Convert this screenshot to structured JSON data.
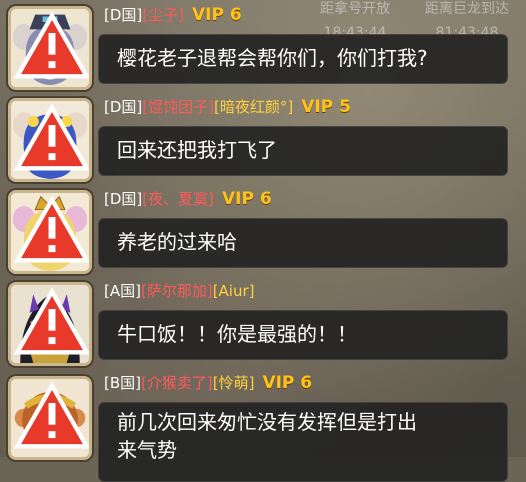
{
  "hud": {
    "left_title": "距拿号开放",
    "left_time": "18:43:44",
    "right_title": "距离巨龙到达",
    "right_time": "81:43:48"
  },
  "messages": [
    {
      "server": "[D国]",
      "nick": "[尘子]",
      "tag": "",
      "vip": "VIP 6",
      "text": "樱花老子退帮会帮你们，你们打我?"
    },
    {
      "server": "[D国]",
      "nick": "[馄饨团子]",
      "tag": "[暗夜红颜°]",
      "vip": "VIP 5",
      "text": "回来还把我打飞了"
    },
    {
      "server": "[D国]",
      "nick": "[夜、夏寞]",
      "tag": "",
      "vip": "VIP 6",
      "text": "养老的过来哈"
    },
    {
      "server": "[A国]",
      "nick": "[萨尔那加]",
      "tag": "[Aiur]",
      "vip": "",
      "text": "牛口饭！！你是最强的！！"
    },
    {
      "server": "[B国]",
      "nick": "[介猴卖了]",
      "tag": "[怜萌]",
      "vip": "VIP 6",
      "text": "前几次回来匆忙没有发挥但是打出",
      "text2": "来气势"
    }
  ],
  "avatars": [
    "mouse-girl-hat-icon",
    "mouse-girl-blue-hair-icon",
    "mouse-girl-crown-icon",
    "dark-knight-icon",
    "monkey-king-icon"
  ]
}
